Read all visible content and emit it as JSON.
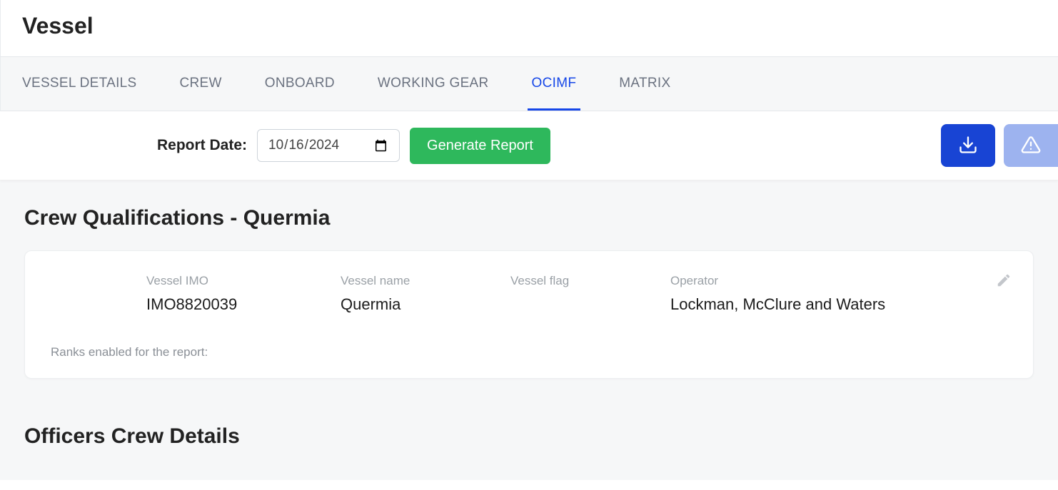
{
  "page": {
    "title": "Vessel"
  },
  "tabs": [
    {
      "label": "VESSEL DETAILS",
      "active": false
    },
    {
      "label": "CREW",
      "active": false
    },
    {
      "label": "ONBOARD",
      "active": false
    },
    {
      "label": "WORKING GEAR",
      "active": false
    },
    {
      "label": "OCIMF",
      "active": true
    },
    {
      "label": "MATRIX",
      "active": false
    }
  ],
  "toolbar": {
    "report_date_label": "Report Date:",
    "report_date_value": "2024-10-16",
    "generate_label": "Generate Report"
  },
  "section": {
    "crew_qual_title": "Crew Qualifications - Quermia",
    "officers_title": "Officers Crew Details"
  },
  "vessel_card": {
    "imo_label": "Vessel IMO",
    "imo_value": "IMO8820039",
    "name_label": "Vessel name",
    "name_value": "Quermia",
    "flag_label": "Vessel flag",
    "flag_value": "",
    "operator_label": "Operator",
    "operator_value": "Lockman, McClure and Waters",
    "ranks_note": "Ranks enabled for the report:"
  }
}
